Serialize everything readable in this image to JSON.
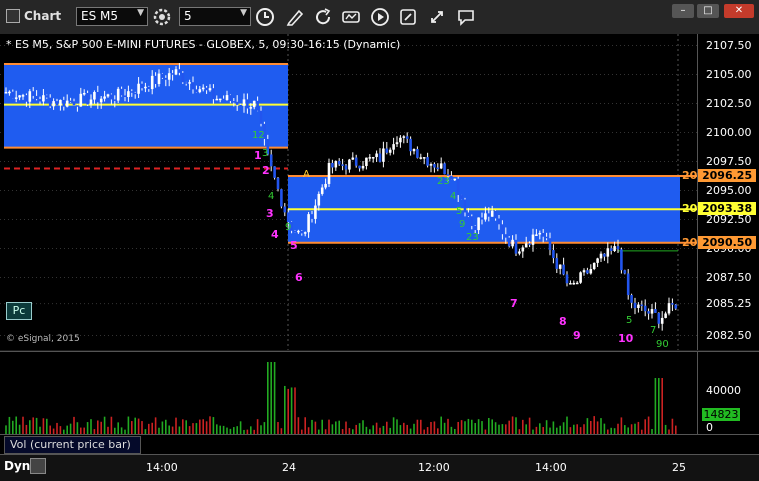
{
  "window": {
    "title": "Chart"
  },
  "toolbar": {
    "symbol": "ES M5",
    "interval": "5"
  },
  "chart": {
    "title": "* ES M5, S&P 500 E-MINI FUTURES - GLOBEX, 5, 09:30-16:15 (Dynamic)",
    "copyright": "© eSignal, 2015",
    "pc_label": "Pc"
  },
  "price_axis": {
    "ticks": [
      "2107.50",
      "2105.00",
      "2102.50",
      "2100.00",
      "2097.50",
      "2095.00",
      "2092.50",
      "2090.00",
      "2087.50",
      "2085.25",
      "2082.50"
    ],
    "tick_values": [
      2107.5,
      2105.0,
      2102.5,
      2100.0,
      2097.5,
      2095.0,
      2092.5,
      2090.0,
      2087.5,
      2085.25,
      2082.5
    ],
    "badges": [
      {
        "text": "2096.25",
        "prefix": "209",
        "value": 2096.25,
        "bg": "#ff9933",
        "fg": "#000000"
      },
      {
        "text": "2093.38",
        "prefix": "209",
        "value": 2093.38,
        "bg": "#ffff33",
        "fg": "#000000"
      },
      {
        "text": "2090.50",
        "prefix": "209",
        "value": 2090.5,
        "bg": "#ff9933",
        "fg": "#000000"
      }
    ],
    "last": "2085.25"
  },
  "time_axis": {
    "ticks": [
      "14:00",
      "24",
      "12:00",
      "14:00",
      "25"
    ]
  },
  "volume": {
    "label": "Vol (current price bar)",
    "ticks": [
      "40000",
      "0"
    ],
    "last": "14823"
  },
  "counts_magenta": [
    "1",
    "2",
    "3",
    "4",
    "5",
    "6",
    "7",
    "8",
    "9",
    "10"
  ],
  "counts_green": [
    "12",
    "3",
    "4",
    "9",
    "A",
    "23",
    "4",
    "5",
    "9",
    "23",
    "5",
    "7",
    "90"
  ],
  "bottom": {
    "dyn": "Dyn"
  },
  "colors": {
    "zone_fill": "#1f5cf0",
    "zone_edge": "#ff8c33",
    "mid_line": "#ffff33",
    "dashed": "#dd2222",
    "magenta": "#ff33ff",
    "candle": "#2255ee"
  },
  "icons": [
    "chart-icon",
    "settings-gear-icon",
    "clock-icon",
    "pencil-icon",
    "refresh-icon",
    "study-icon",
    "play-icon",
    "link-icon",
    "cursor-icon",
    "note-icon"
  ]
}
